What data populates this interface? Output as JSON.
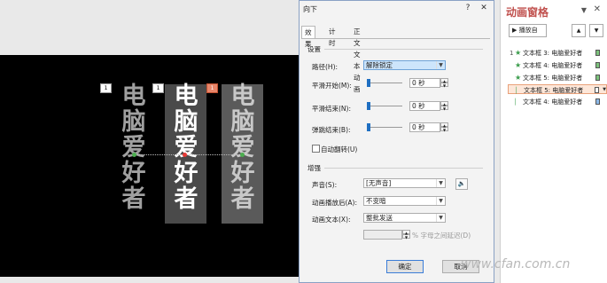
{
  "slide": {
    "text_boxes": [
      {
        "tag": "1",
        "text": [
          "电",
          "脑",
          "爱",
          "好",
          "者"
        ],
        "color": "#a0a0a0"
      },
      {
        "tag": "1",
        "text": [
          "电",
          "脑",
          "爱",
          "好",
          "者"
        ],
        "color": "#ffffff"
      },
      {
        "tag": "1",
        "text": [
          "电",
          "脑",
          "爱",
          "好",
          "者"
        ],
        "color": "#c8c8c8"
      }
    ]
  },
  "dialog": {
    "title": "向下",
    "help": "?",
    "close": "✕",
    "tabs": [
      "效果",
      "计时",
      "正文文本动画"
    ],
    "settings_section": "设置",
    "path_label": "路径(H):",
    "path_value": "解除锁定",
    "smooth_start_label": "平滑开始(M):",
    "smooth_start_value": "0 秒",
    "smooth_end_label": "平滑结束(N):",
    "smooth_end_value": "0 秒",
    "bounce_end_label": "弹跳结束(B):",
    "bounce_end_value": "0 秒",
    "auto_reverse_label": "自动翻转(U)",
    "enhance_section": "增强",
    "sound_label": "声音(S):",
    "sound_value": "[无声音]",
    "after_anim_label": "动画播放后(A):",
    "after_anim_value": "不变暗",
    "anim_text_label": "动画文本(X):",
    "anim_text_value": "整批发送",
    "letter_delay_label": "% 字母之间延迟(D)",
    "ok": "确定",
    "cancel": "取消"
  },
  "pane": {
    "title": "动画窗格",
    "play_label": "播放自",
    "items": [
      {
        "num": "1",
        "star": "★",
        "label": "文本框 3: 电脑爱好者",
        "bar_color": "#7cc27c"
      },
      {
        "num": "",
        "star": "★",
        "label": "文本框 4: 电脑爱好者",
        "bar_color": "#7cc27c"
      },
      {
        "num": "",
        "star": "★",
        "label": "文本框 5: 电脑爱好者",
        "bar_color": "#7cc27c"
      },
      {
        "num": "",
        "star": "",
        "label": "文本框 5: 电脑爱好者",
        "bar_color": "#ffffff"
      },
      {
        "num": "",
        "star": "",
        "label": "文本框 4: 电脑爱好者",
        "bar_color": "#8bb8e8"
      }
    ]
  },
  "watermark": "www.cfan.com.cn"
}
